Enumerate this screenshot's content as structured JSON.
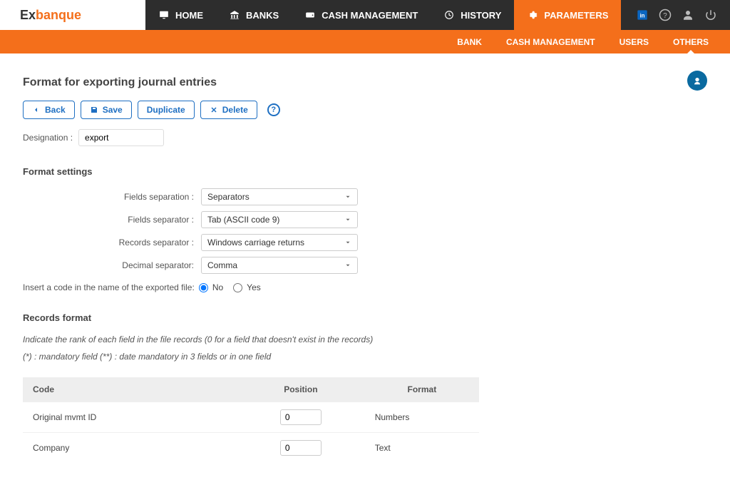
{
  "logo": {
    "prefix": "Ex",
    "suffix": "banque"
  },
  "nav": {
    "home": "HOME",
    "banks": "BANKS",
    "cash": "CASH MANAGEMENT",
    "history": "HISTORY",
    "parameters": "PARAMETERS"
  },
  "subnav": {
    "bank": "BANK",
    "cash": "CASH MANAGEMENT",
    "users": "USERS",
    "others": "OTHERS"
  },
  "page": {
    "title": "Format for exporting journal entries"
  },
  "toolbar": {
    "back": "Back",
    "save": "Save",
    "duplicate": "Duplicate",
    "delete": "Delete",
    "help": "?"
  },
  "designation": {
    "label": "Designation :",
    "value": "export"
  },
  "sections": {
    "format_settings": "Format settings",
    "records_format": "Records format"
  },
  "settings": {
    "fields_separation_label": "Fields separation :",
    "fields_separation_value": "Separators",
    "fields_separator_label": "Fields separator :",
    "fields_separator_value": "Tab (ASCII code 9)",
    "records_separator_label": "Records separator :",
    "records_separator_value": "Windows carriage returns",
    "decimal_separator_label": "Decimal separator:",
    "decimal_separator_value": "Comma",
    "insert_code_label": "Insert a code in the name of the exported file:",
    "no": "No",
    "yes": "Yes"
  },
  "instructions": {
    "rank": "Indicate the rank of each field in the file records (0 for a field that doesn't exist in the records)",
    "mandatory": "(*) : mandatory field (**) : date mandatory in 3 fields or in one field"
  },
  "table": {
    "headers": {
      "code": "Code",
      "position": "Position",
      "format": "Format"
    },
    "rows": [
      {
        "code": "Original mvmt ID",
        "position": "0",
        "format": "Numbers"
      },
      {
        "code": "Company",
        "position": "0",
        "format": "Text"
      }
    ]
  }
}
